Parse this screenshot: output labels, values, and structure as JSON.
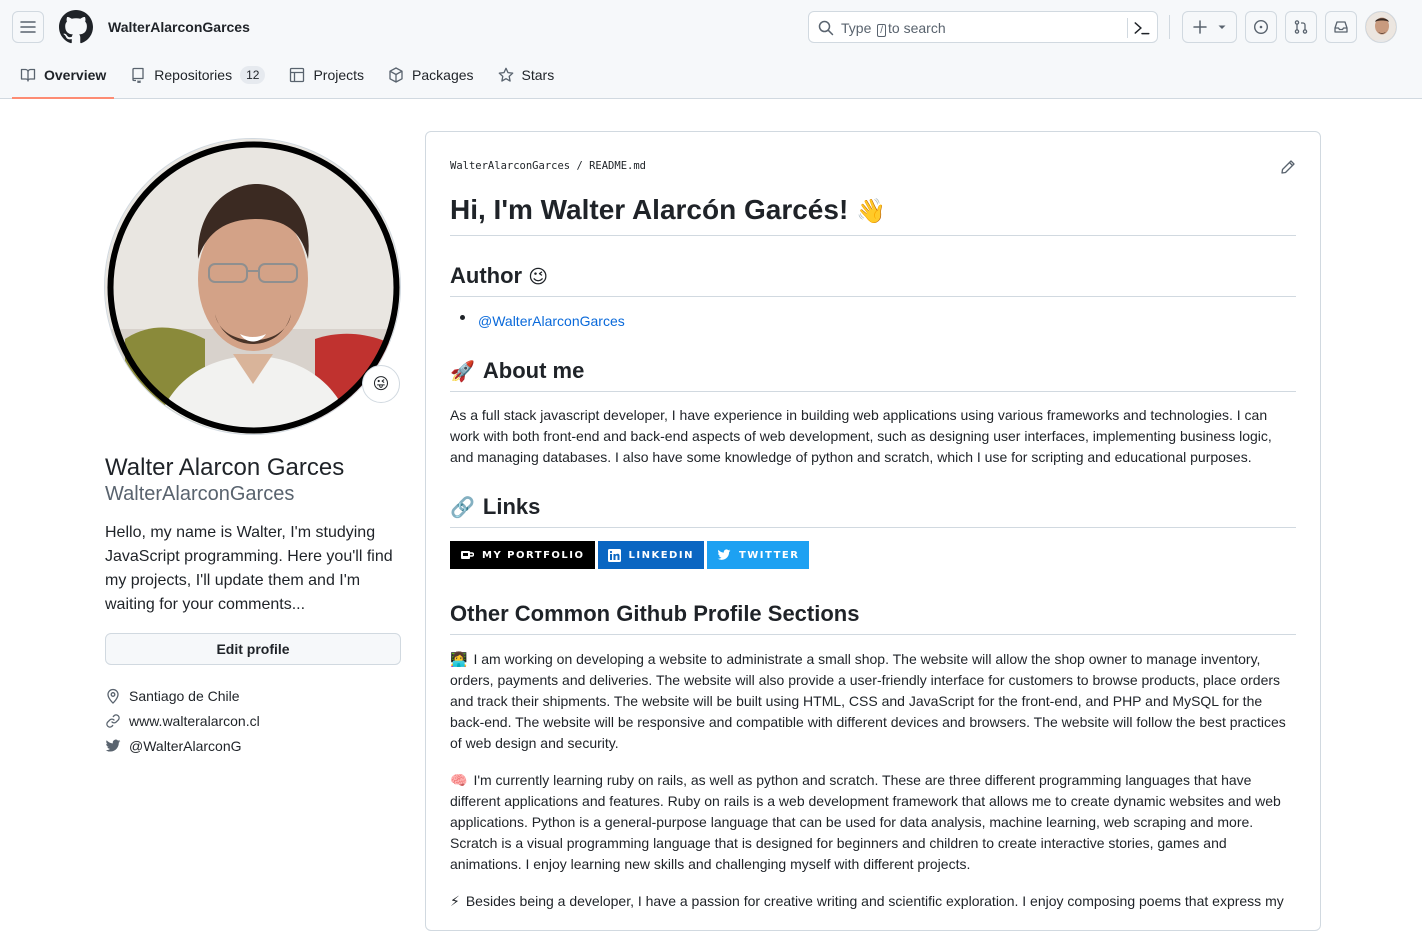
{
  "header": {
    "owner": "WalterAlarconGarces",
    "search_prefix": "Type",
    "search_key": "/",
    "search_suffix": "to search"
  },
  "tabs": [
    {
      "label": "Overview",
      "icon": "book-icon",
      "active": true
    },
    {
      "label": "Repositories",
      "icon": "repo-icon",
      "count": "12"
    },
    {
      "label": "Projects",
      "icon": "table-icon"
    },
    {
      "label": "Packages",
      "icon": "package-icon"
    },
    {
      "label": "Stars",
      "icon": "star-icon"
    }
  ],
  "profile": {
    "name": "Walter Alarcon Garces",
    "username": "WalterAlarconGarces",
    "status_emoji": "😜",
    "bio": "Hello, my name is Walter, I'm studying JavaScript programming. Here you'll find my projects, I'll update them and I'm waiting for your comments...",
    "edit_label": "Edit profile",
    "location": "Santiago de Chile",
    "website": "www.walteralarcon.cl",
    "twitter": "@WalterAlarconG"
  },
  "readme": {
    "crumb_owner": "WalterAlarconGarces",
    "crumb_sep": "/",
    "crumb_file": "README.md",
    "title": "Hi, I'm Walter Alarcón Garcés!",
    "title_emoji": "👋",
    "author_heading": "Author",
    "author_emoji": "😉",
    "author_link": "@WalterAlarconGarces",
    "about_emoji": "🚀",
    "about_heading": "About me",
    "about_text": "As a full stack javascript developer, I have experience in building web applications using various frameworks and technologies. I can work with both front-end and back-end aspects of web development, such as designing user interfaces, implementing business logic, and managing databases. I also have some knowledge of python and scratch, which I use for scripting and educational purposes.",
    "links_emoji": "🔗",
    "links_heading": "Links",
    "badges": [
      {
        "label": "MY PORTFOLIO",
        "color": "#000000",
        "icon": "portfolio-icon"
      },
      {
        "label": "LINKEDIN",
        "color": "#0a66c2",
        "icon": "linkedin-icon"
      },
      {
        "label": "TWITTER",
        "color": "#1da1f2",
        "icon": "twitter-icon"
      }
    ],
    "other_heading": "Other Common Github Profile Sections",
    "working_emoji": "👩‍💻",
    "working_text": "I am working on developing a website to administrate a small shop. The website will allow the shop owner to manage inventory, orders, payments and deliveries. The website will also provide a user-friendly interface for customers to browse products, place orders and track their shipments. The website will be built using HTML, CSS and JavaScript for the front-end, and PHP and MySQL for the back-end. The website will be responsive and compatible with different devices and browsers. The website will follow the best practices of web design and security.",
    "learning_emoji": "🧠",
    "learning_text": "I'm currently learning ruby on rails, as well as python and scratch. These are three different programming languages that have different applications and features. Ruby on rails is a web development framework that allows me to create dynamic websites and web applications. Python is a general-purpose language that can be used for data analysis, machine learning, web scraping and more. Scratch is a visual programming language that is designed for beginners and children to create interactive stories, games and animations. I enjoy learning new skills and challenging myself with different projects.",
    "passion_emoji": "⚡",
    "passion_text": "Besides being a developer, I have a passion for creative writing and scientific exploration. I enjoy composing poems that express my"
  }
}
